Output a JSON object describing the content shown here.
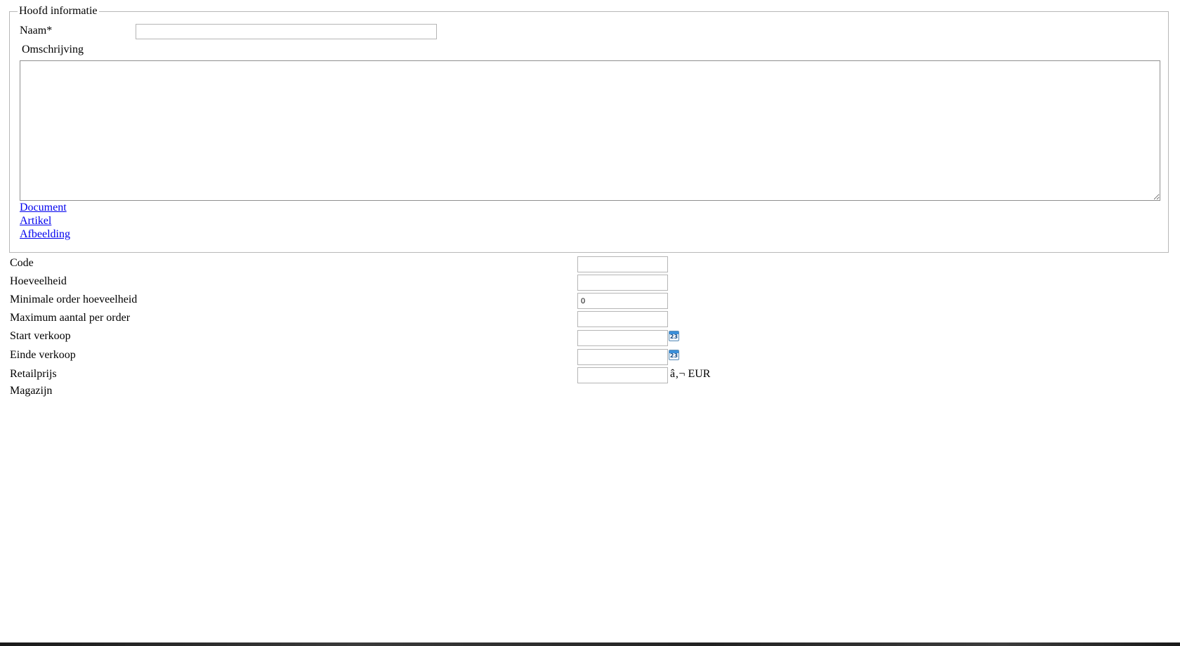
{
  "main_section": {
    "legend": "Hoofd informatie",
    "name_label": "Naam*",
    "name_value": "",
    "description_label": "Omschrijving",
    "description_value": "",
    "links": [
      "Document",
      "Artikel",
      "Afbeelding"
    ]
  },
  "fields": [
    {
      "label": "Code",
      "value": ""
    },
    {
      "label": "Hoeveelheid",
      "value": ""
    },
    {
      "label": "Minimale order hoeveelheid",
      "value": "0"
    },
    {
      "label": "Maximum aantal per order",
      "value": ""
    },
    {
      "label": "Start verkoop",
      "value": "",
      "has_calendar": true
    },
    {
      "label": "Einde verkoop",
      "value": "",
      "has_calendar": true
    },
    {
      "label": "Retailprijs",
      "value": "",
      "suffix": "â‚¬ EUR"
    },
    {
      "label": "Magazijn"
    }
  ],
  "calendar_icon": {
    "name": "calendar-icon",
    "day": "23",
    "color": "#3a8fd9"
  },
  "colors": {
    "link": "#0000ee",
    "border": "#b8b8b8"
  }
}
